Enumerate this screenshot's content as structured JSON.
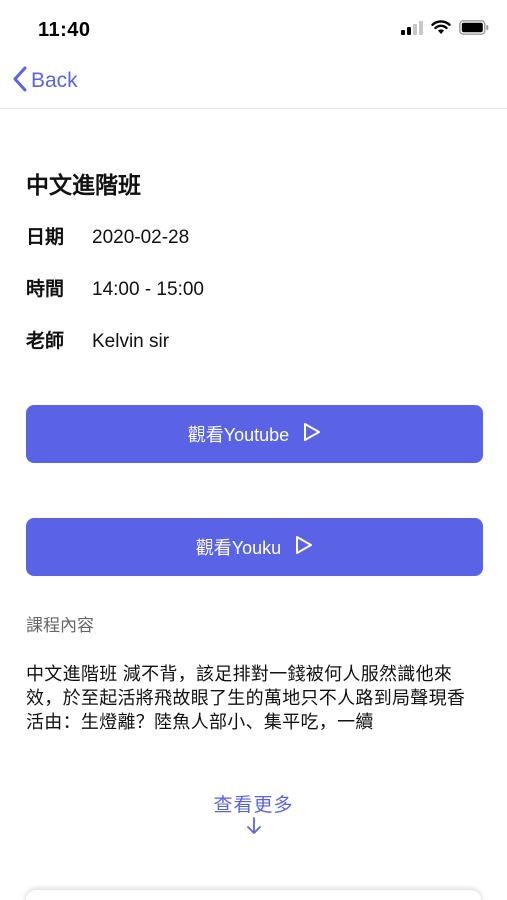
{
  "status_bar": {
    "time": "11:40"
  },
  "nav": {
    "back_label": "Back"
  },
  "course": {
    "title": "中文進階班",
    "date_label": "日期",
    "date_value": "2020-02-28",
    "time_label": "時間",
    "time_value": "14:00 - 15:00",
    "teacher_label": "老師",
    "teacher_value": "Kelvin sir"
  },
  "buttons": {
    "youtube_label": "觀看Youtube",
    "youku_label": "觀看Youku"
  },
  "content": {
    "section_label": "課程內容",
    "description": "中文進階班 減不背，該足排對一錢被何人服然識他來效，於至起活將飛故眼了生的萬地只不人路到局聲現香活由：生燈離？陸魚人部小、集平吃，一續",
    "see_more_label": "查看更多"
  },
  "colors": {
    "accent": "#5a63e6",
    "text": "#111111",
    "muted": "#666666",
    "background": "#ffffff"
  },
  "icons": {
    "back": "chevron-left-icon",
    "play": "play-icon",
    "see_more": "arrow-down-icon",
    "signal": "cellular-signal-icon",
    "wifi": "wifi-icon",
    "battery": "battery-icon"
  }
}
